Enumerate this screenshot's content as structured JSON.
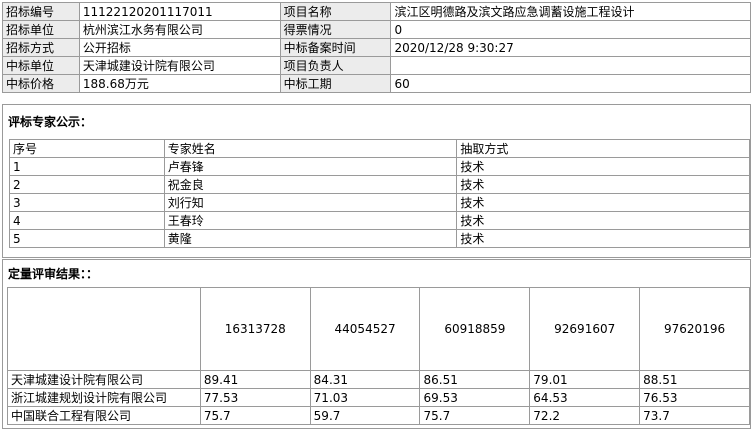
{
  "info": {
    "rows": [
      {
        "label1": "招标编号",
        "value1": "11122120201117011",
        "label2": "项目名称",
        "value2": "滨江区明德路及滨文路应急调蓄设施工程设计"
      },
      {
        "label1": "招标单位",
        "value1": "杭州滨江水务有限公司",
        "label2": "得票情况",
        "value2": "0"
      },
      {
        "label1": "招标方式",
        "value1": "公开招标",
        "label2": "中标备案时间",
        "value2": "2020/12/28 9:30:27"
      },
      {
        "label1": "中标单位",
        "value1": "天津城建设计院有限公司",
        "label2": "项目负责人",
        "value2": ""
      },
      {
        "label1": "中标价格",
        "value1": "188.68万元",
        "label2": "中标工期",
        "value2": "60"
      }
    ]
  },
  "experts": {
    "title": "评标专家公示：",
    "headers": [
      "序号",
      "专家姓名",
      "抽取方式"
    ],
    "rows": [
      [
        "1",
        "卢春锋",
        "技术"
      ],
      [
        "2",
        "祝金良",
        "技术"
      ],
      [
        "3",
        "刘行知",
        "技术"
      ],
      [
        "4",
        "王春玲",
        "技术"
      ],
      [
        "5",
        "黄隆",
        "技术"
      ]
    ]
  },
  "results": {
    "title": "定量评审结果：：",
    "headers": [
      "",
      "16313728",
      "44054527",
      "60918859",
      "92691607",
      "97620196"
    ],
    "rows": [
      [
        "天津城建设计院有限公司",
        "89.41",
        "84.31",
        "86.51",
        "79.01",
        "88.51"
      ],
      [
        "浙江城建规划设计院有限公司",
        "77.53",
        "71.03",
        "69.53",
        "64.53",
        "76.53"
      ],
      [
        "中国联合工程有限公司",
        "75.7",
        "59.7",
        "75.7",
        "72.2",
        "73.7"
      ]
    ]
  }
}
